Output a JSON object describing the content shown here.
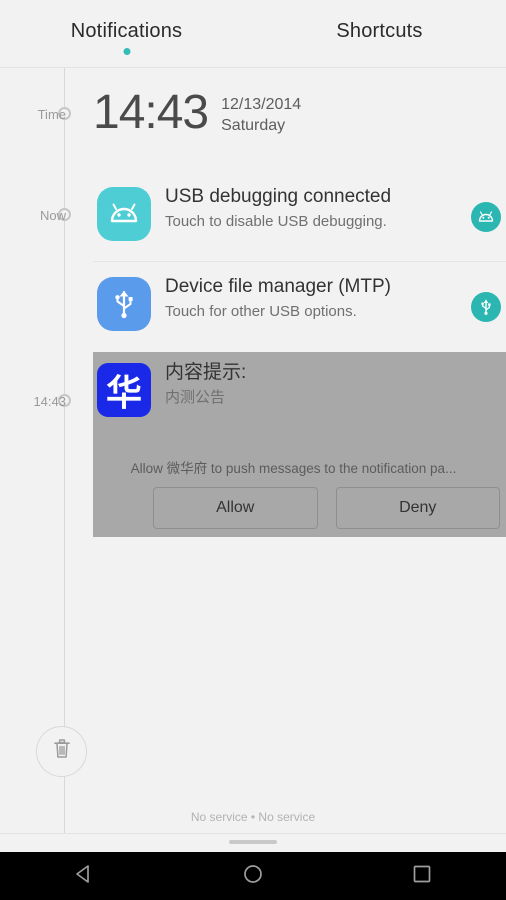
{
  "tabs": [
    {
      "label": "Notifications",
      "active": true
    },
    {
      "label": "Shortcuts",
      "active": false
    }
  ],
  "timeline": {
    "markers": [
      {
        "label": "Time"
      },
      {
        "label": "Now"
      },
      {
        "label": "14:43"
      }
    ]
  },
  "clock": {
    "time": "14:43",
    "date": "12/13/2014",
    "weekday": "Saturday"
  },
  "notifications": [
    {
      "title": "USB debugging connected",
      "subtitle": "Touch to disable USB debugging.",
      "icon": "android-head-icon",
      "icon_color": "#4ecdd4",
      "badge_icon": "android-head-badge-icon",
      "badge_color": "#2bb6b2"
    },
    {
      "title": "Device file manager (MTP)",
      "subtitle": "Touch for other USB options.",
      "icon": "usb-icon",
      "icon_color": "#5b9bec",
      "badge_icon": "usb-badge-icon",
      "badge_color": "#2bb6b2"
    },
    {
      "title": "内容提示:",
      "subtitle": "内测公告",
      "icon": "hua-app-icon",
      "icon_glyph": "华",
      "icon_color": "#1a28e8",
      "permission_text": "Allow 微华府 to push messages to the notification pa...",
      "allow_label": "Allow",
      "deny_label": "Deny",
      "panel_color": "#a8a8a8"
    }
  ],
  "clear_button": {
    "icon": "trash-icon"
  },
  "status": {
    "carrier": "No service • No service"
  },
  "navbar": {
    "back": "back-triangle-icon",
    "home": "home-circle-icon",
    "recents": "recents-square-icon"
  },
  "colors": {
    "accent": "#33bcb7",
    "background": "#f2f2f2",
    "navbar": "#000000"
  }
}
